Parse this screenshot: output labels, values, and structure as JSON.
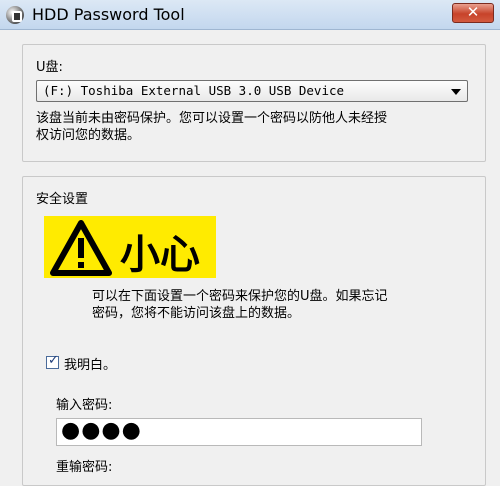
{
  "window": {
    "title": "HDD Password Tool",
    "close_label": "✕"
  },
  "drive_group": {
    "label": "U盘:",
    "selected_drive": "(F:) Toshiba External USB 3.0 USB Device",
    "description_line1": "该盘当前未由密码保护。您可以设置一个密码以防他人未经授",
    "description_line2": "权访问您的数据。"
  },
  "security_group": {
    "label": "安全设置",
    "warning_title": "小心",
    "warning_line1": "可以在下面设置一个密码来保护您的U盘。如果忘记",
    "warning_line2": "密码，您将不能访问该盘上的数据。",
    "understand_label": "我明白。",
    "understand_checked": true,
    "enter_password_label": "输入密码:",
    "password_value": "●●●●",
    "confirm_password_label": "重输密码:"
  },
  "colors": {
    "warning_banner": "#ffeb00",
    "close_button": "#c7432a"
  }
}
